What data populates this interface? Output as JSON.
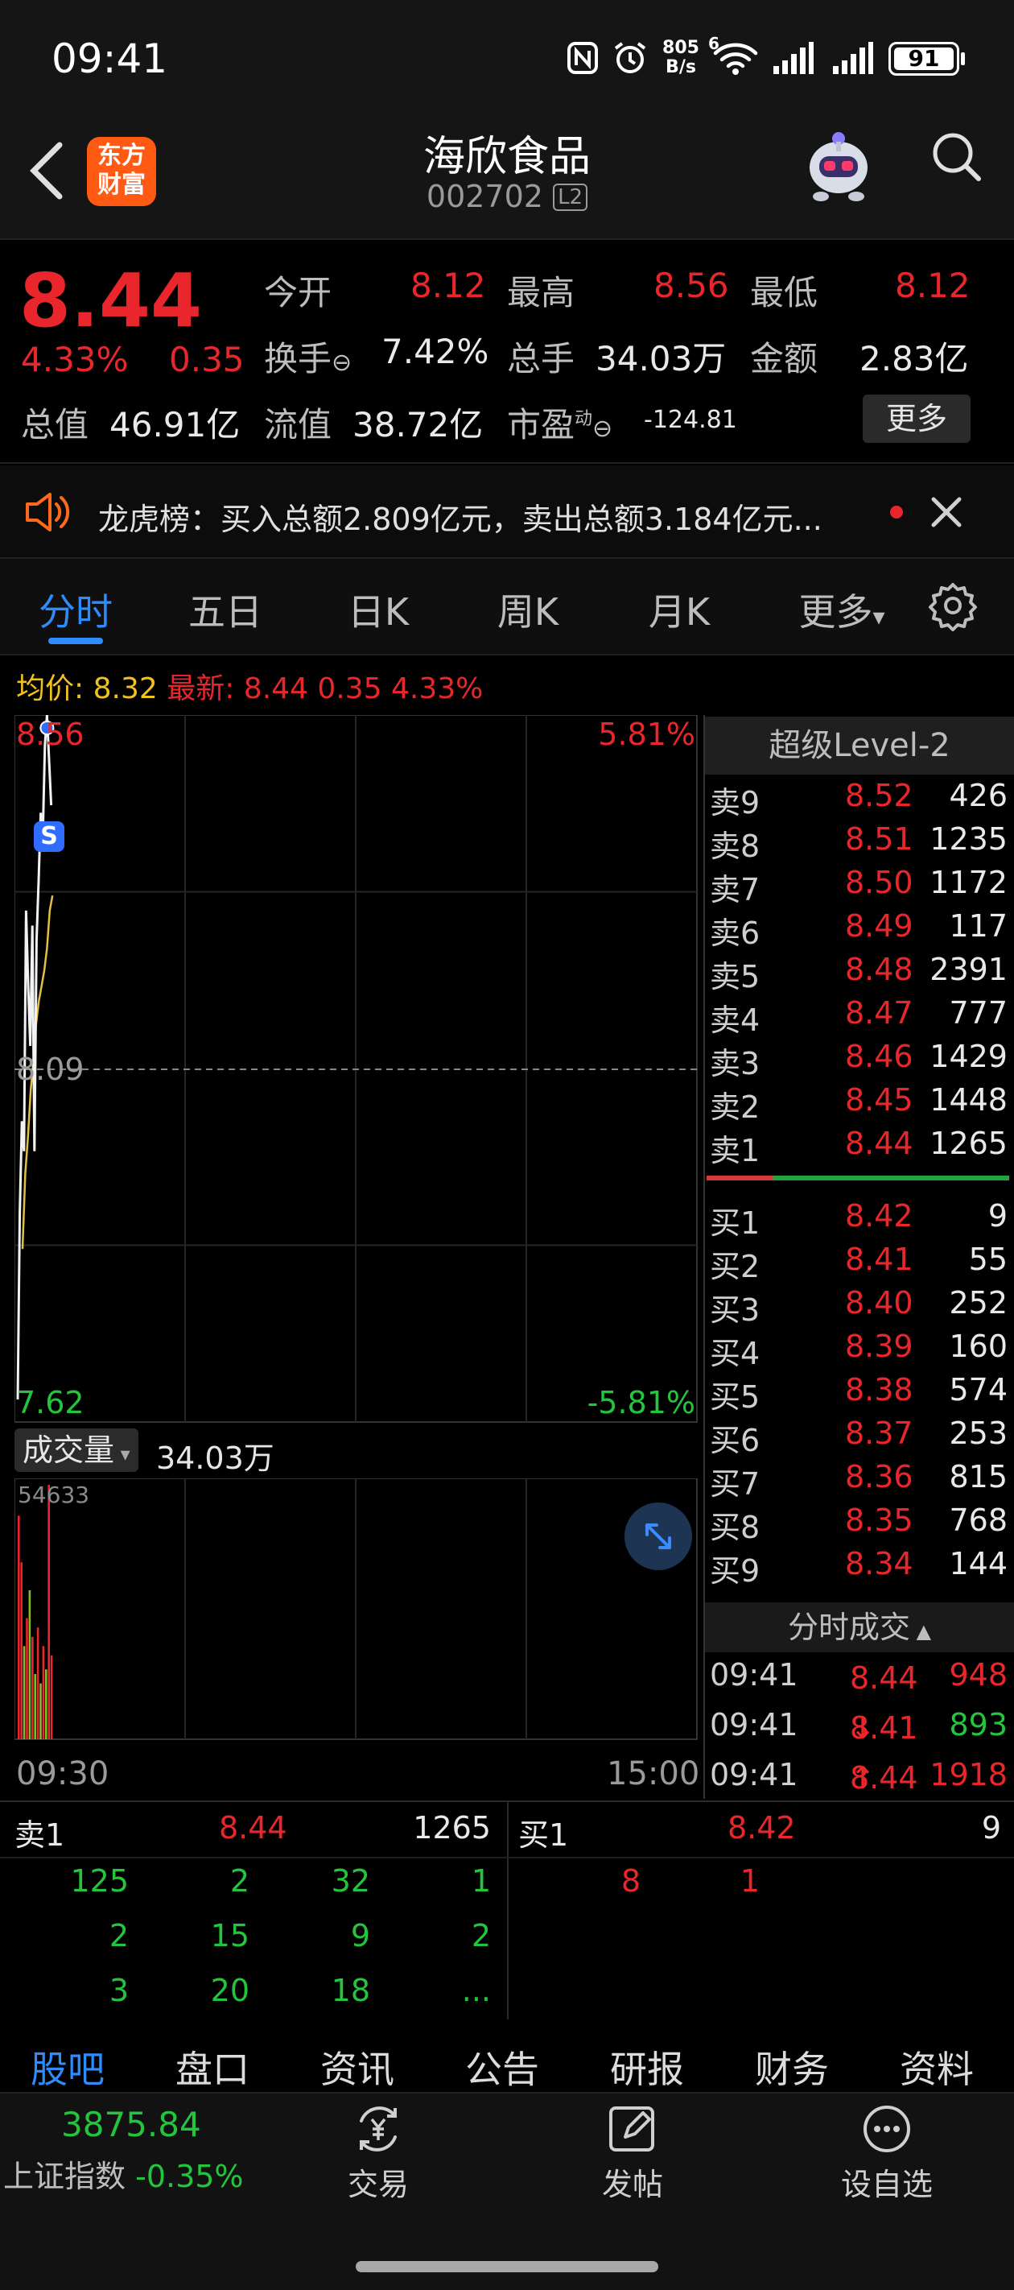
{
  "status_bar": {
    "time": "09:41",
    "net_speed_top": "805",
    "net_speed_bottom": "B/s",
    "wifi_label": "6",
    "battery": "91"
  },
  "nav": {
    "logo_line1": "东方",
    "logo_line2": "财富",
    "stock_name": "海欣食品",
    "stock_code": "002702",
    "level_badge": "L2"
  },
  "quote": {
    "price": "8.44",
    "change_pct": "4.33%",
    "change": "0.35",
    "open_label": "今开",
    "open": "8.12",
    "high_label": "最高",
    "high": "8.56",
    "low_label": "最低",
    "low": "8.12",
    "turnover_label": "换手",
    "turnover": "7.42%",
    "volume_label": "总手",
    "volume": "34.03万",
    "amount_label": "金额",
    "amount": "2.83亿",
    "mktcap_label": "总值",
    "mktcap": "46.91亿",
    "float_label": "流值",
    "float": "38.72亿",
    "pe_label": "市盈",
    "pe_sup": "动",
    "pe": "-124.81",
    "more_button": "更多"
  },
  "ticker": {
    "text": "龙虎榜：买入总额2.809亿元，卖出总额3.184亿元..."
  },
  "tabs": [
    "分时",
    "五日",
    "日K",
    "周K",
    "月K",
    "更多"
  ],
  "chart_info": {
    "avg_label": "均价:",
    "avg": "8.32",
    "latest_label": "最新:",
    "latest": "8.44 0.35 4.33%"
  },
  "chart_data": {
    "type": "line",
    "y_top": "8.56",
    "y_mid": "8.09",
    "y_bottom": "7.62",
    "pct_top": "5.81%",
    "pct_bottom": "-5.81%",
    "ylim": [
      7.62,
      8.56
    ],
    "x_start": "09:30",
    "x_end": "15:00",
    "price_series": [
      7.65,
      7.9,
      8.02,
      7.98,
      8.3,
      8.2,
      8.12,
      8.28,
      7.98,
      8.26,
      8.34,
      8.43,
      8.4,
      8.52,
      8.56,
      8.5,
      8.44
    ],
    "avg_series": [
      7.85,
      7.95,
      8.0,
      8.06,
      8.1,
      8.15,
      8.18,
      8.2,
      8.22,
      8.25,
      8.3,
      8.32
    ],
    "volume_label": "成交量",
    "volume_total": "34.03万",
    "volume_max": "54633",
    "volume_bars": [
      {
        "v": 48000,
        "c": "red"
      },
      {
        "v": 38000,
        "c": "red"
      },
      {
        "v": 20000,
        "c": "green"
      },
      {
        "v": 26000,
        "c": "red"
      },
      {
        "v": 32000,
        "c": "green"
      },
      {
        "v": 22000,
        "c": "red"
      },
      {
        "v": 14000,
        "c": "green"
      },
      {
        "v": 24000,
        "c": "red"
      },
      {
        "v": 12000,
        "c": "green"
      },
      {
        "v": 20000,
        "c": "red"
      },
      {
        "v": 15000,
        "c": "green"
      },
      {
        "v": 54633,
        "c": "red"
      },
      {
        "v": 18000,
        "c": "red"
      }
    ]
  },
  "orderbook": {
    "title": "超级Level-2",
    "asks": [
      {
        "label": "卖9",
        "price": "8.52",
        "vol": "426"
      },
      {
        "label": "卖8",
        "price": "8.51",
        "vol": "1235"
      },
      {
        "label": "卖7",
        "price": "8.50",
        "vol": "1172"
      },
      {
        "label": "卖6",
        "price": "8.49",
        "vol": "117"
      },
      {
        "label": "卖5",
        "price": "8.48",
        "vol": "2391"
      },
      {
        "label": "卖4",
        "price": "8.47",
        "vol": "777"
      },
      {
        "label": "卖3",
        "price": "8.46",
        "vol": "1429"
      },
      {
        "label": "卖2",
        "price": "8.45",
        "vol": "1448"
      },
      {
        "label": "卖1",
        "price": "8.44",
        "vol": "1265"
      }
    ],
    "bids": [
      {
        "label": "买1",
        "price": "8.42",
        "vol": "9"
      },
      {
        "label": "买2",
        "price": "8.41",
        "vol": "55"
      },
      {
        "label": "买3",
        "price": "8.40",
        "vol": "252"
      },
      {
        "label": "买4",
        "price": "8.39",
        "vol": "160"
      },
      {
        "label": "买5",
        "price": "8.38",
        "vol": "574"
      },
      {
        "label": "买6",
        "price": "8.37",
        "vol": "253"
      },
      {
        "label": "买7",
        "price": "8.36",
        "vol": "815"
      },
      {
        "label": "买8",
        "price": "8.35",
        "vol": "768"
      },
      {
        "label": "买9",
        "price": "8.34",
        "vol": "144"
      }
    ],
    "trades_title": "分时成交",
    "trades": [
      {
        "time": "09:41",
        "price": "8.44",
        "arrow": "",
        "vol": "948",
        "vol_color": "red"
      },
      {
        "time": "09:41",
        "price": "8.41",
        "arrow": "↓",
        "vol": "893",
        "vol_color": "green"
      },
      {
        "time": "09:41",
        "price": "8.44",
        "arrow": "↑",
        "vol": "1918",
        "vol_color": "red"
      }
    ]
  },
  "queue": {
    "sell_label": "卖1",
    "sell_price": "8.44",
    "sell_vol": "1265",
    "buy_label": "买1",
    "buy_price": "8.42",
    "buy_vol": "9",
    "sell_rows": [
      [
        "125",
        "2",
        "32",
        "1"
      ],
      [
        "2",
        "15",
        "9",
        "2"
      ],
      [
        "3",
        "20",
        "18",
        "..."
      ]
    ],
    "buy_rows": [
      [
        "8",
        "1"
      ]
    ]
  },
  "bottom_tabs": [
    "股吧",
    "盘口",
    "资讯",
    "公告",
    "研报",
    "财务",
    "资料"
  ],
  "bottom_bar": {
    "index_value": "3875.84",
    "index_name": "上证指数",
    "index_change": "-0.35%",
    "trade_label": "交易",
    "post_label": "发帖",
    "watch_label": "设自选"
  }
}
